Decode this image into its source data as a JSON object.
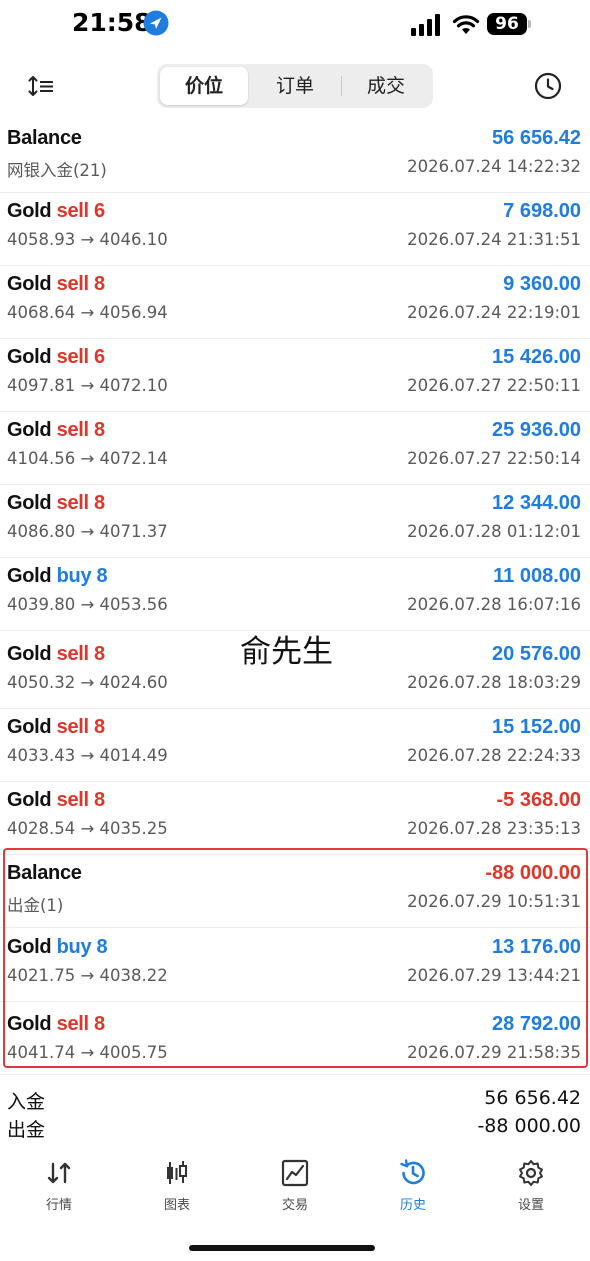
{
  "status_bar": {
    "time": "21:58",
    "battery": "96"
  },
  "toolbar": {
    "tabs": [
      {
        "label": "价位"
      },
      {
        "label": "订单"
      },
      {
        "label": "成交"
      }
    ],
    "active_tab": "价位"
  },
  "entries": [
    {
      "kind": "balance",
      "title": "Balance",
      "detail": "网银入金(21)",
      "amount": "56 656.42",
      "amount_sign": "positive",
      "time": "2026.07.24 14:22:32"
    },
    {
      "kind": "trade",
      "symbol": "Gold",
      "side": "sell",
      "side_label": "sell 6",
      "prices": "4058.93 → 4046.10",
      "amount": "7 698.00",
      "amount_sign": "positive",
      "time": "2026.07.24 21:31:51"
    },
    {
      "kind": "trade",
      "symbol": "Gold",
      "side": "sell",
      "side_label": "sell 8",
      "prices": "4068.64 → 4056.94",
      "amount": "9 360.00",
      "amount_sign": "positive",
      "time": "2026.07.24 22:19:01"
    },
    {
      "kind": "trade",
      "symbol": "Gold",
      "side": "sell",
      "side_label": "sell 6",
      "prices": "4097.81 → 4072.10",
      "amount": "15 426.00",
      "amount_sign": "positive",
      "time": "2026.07.27 22:50:11"
    },
    {
      "kind": "trade",
      "symbol": "Gold",
      "side": "sell",
      "side_label": "sell 8",
      "prices": "4104.56 → 4072.14",
      "amount": "25 936.00",
      "amount_sign": "positive",
      "time": "2026.07.27 22:50:14"
    },
    {
      "kind": "trade",
      "symbol": "Gold",
      "side": "sell",
      "side_label": "sell 8",
      "prices": "4086.80 → 4071.37",
      "amount": "12 344.00",
      "amount_sign": "positive",
      "time": "2026.07.28 01:12:01"
    },
    {
      "kind": "trade",
      "symbol": "Gold",
      "side": "buy",
      "side_label": "buy 8",
      "prices": "4039.80 → 4053.56",
      "amount": "11 008.00",
      "amount_sign": "positive",
      "time": "2026.07.28 16:07:16"
    },
    {
      "kind": "trade",
      "symbol": "Gold",
      "side": "sell",
      "side_label": "sell 8",
      "prices": "4050.32 → 4024.60",
      "amount": "20 576.00",
      "amount_sign": "positive",
      "time": "2026.07.28 18:03:29"
    },
    {
      "kind": "trade",
      "symbol": "Gold",
      "side": "sell",
      "side_label": "sell 8",
      "prices": "4033.43 → 4014.49",
      "amount": "15 152.00",
      "amount_sign": "positive",
      "time": "2026.07.28 22:24:33"
    },
    {
      "kind": "trade",
      "symbol": "Gold",
      "side": "sell",
      "side_label": "sell 8",
      "prices": "4028.54 → 4035.25",
      "amount": "-5 368.00",
      "amount_sign": "negative",
      "time": "2026.07.28 23:35:13"
    },
    {
      "kind": "balance",
      "title": "Balance",
      "detail": "出金(1)",
      "amount": "-88 000.00",
      "amount_sign": "negative",
      "time": "2026.07.29 10:51:31"
    },
    {
      "kind": "trade",
      "symbol": "Gold",
      "side": "buy",
      "side_label": "buy 8",
      "prices": "4021.75 → 4038.22",
      "amount": "13 176.00",
      "amount_sign": "positive",
      "time": "2026.07.29 13:44:21"
    },
    {
      "kind": "trade",
      "symbol": "Gold",
      "side": "sell",
      "side_label": "sell 8",
      "prices": "4041.74 → 4005.75",
      "amount": "28 792.00",
      "amount_sign": "positive",
      "time": "2026.07.29 21:58:35"
    }
  ],
  "watermark": "俞先生",
  "summary": {
    "deposit_label": "入金",
    "deposit_value": "56 656.42",
    "withdraw_label": "出金",
    "withdraw_value": "-88 000.00"
  },
  "tabbar": {
    "items": [
      {
        "label": "行情",
        "icon": "quotes-icon"
      },
      {
        "label": "图表",
        "icon": "chart-candles-icon"
      },
      {
        "label": "交易",
        "icon": "trade-chart-icon"
      },
      {
        "label": "历史",
        "icon": "history-icon"
      },
      {
        "label": "设置",
        "icon": "settings-gear-icon"
      }
    ],
    "active": "历史"
  },
  "colors": {
    "profit": "#1f7de0",
    "loss": "#e0362a",
    "highlight": "#e0393f"
  }
}
